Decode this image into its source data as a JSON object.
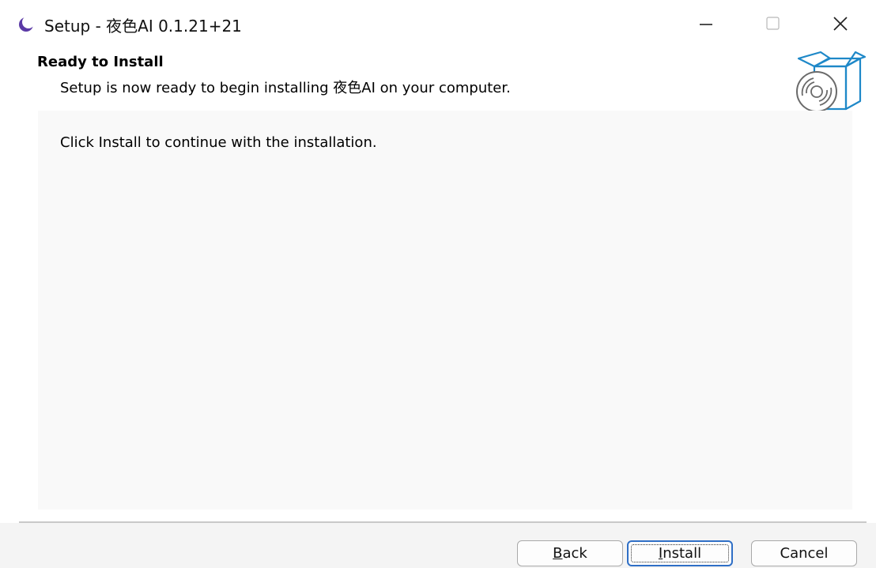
{
  "window": {
    "title": "Setup - 夜色AI 0.1.21+21",
    "icon": "moon-icon",
    "controls": [
      "minimize-icon",
      "maximize-icon",
      "close-icon"
    ]
  },
  "header": {
    "heading": "Ready to Install",
    "subheading": "Setup is now ready to begin installing 夜色AI on your computer.",
    "graphic": "software-box-disc-icon"
  },
  "content": {
    "instruction": "Click Install to continue with the installation."
  },
  "buttons": {
    "back": {
      "mnemonic": "B",
      "rest": "ack"
    },
    "install": {
      "mnemonic": "I",
      "rest": "nstall"
    },
    "cancel": {
      "label": "Cancel"
    }
  },
  "colors": {
    "accent": "#2f6fc6",
    "box_outline": "#1e88c8",
    "icon_purple": "#5b3aa6"
  }
}
